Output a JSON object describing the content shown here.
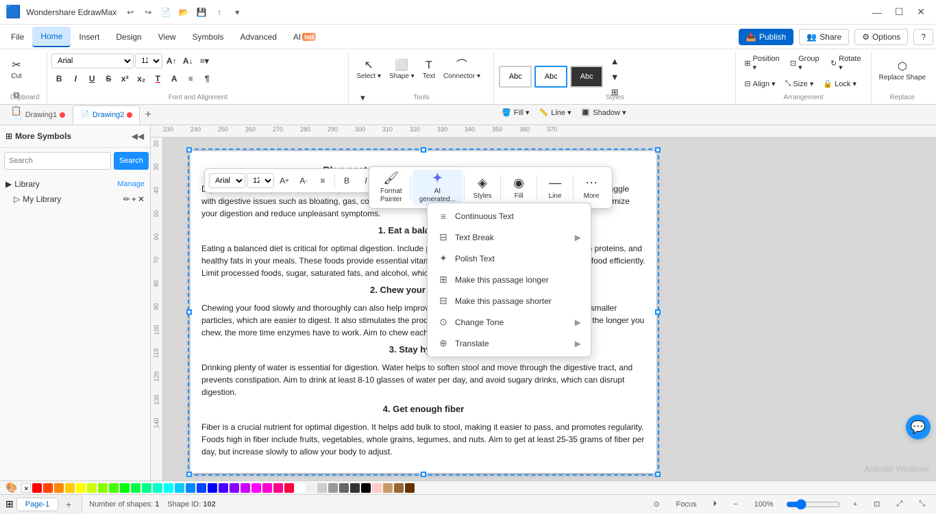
{
  "app": {
    "title": "Wondershare EdrawMax",
    "icon": "🟦"
  },
  "titlebar": {
    "controls": [
      "minimize",
      "maximize",
      "close"
    ],
    "quick_actions": [
      "undo",
      "redo",
      "new",
      "open",
      "save",
      "share",
      "more"
    ]
  },
  "menubar": {
    "items": [
      "File",
      "Home",
      "Insert",
      "Design",
      "View",
      "Symbols",
      "Advanced",
      "AI"
    ],
    "ai_badge": "hot",
    "active": "Home",
    "right_actions": [
      "Publish",
      "Share",
      "Options",
      "Help"
    ]
  },
  "ribbon": {
    "groups": [
      {
        "name": "Clipboard",
        "tools": [
          "Cut",
          "Copy",
          "Paste",
          "Format Painter"
        ]
      },
      {
        "name": "Font and Alignment",
        "font": "Arial",
        "size": "12",
        "bold": "B",
        "italic": "I",
        "underline": "U",
        "strike": "S",
        "superscript": "x²",
        "subscript": "x₂"
      },
      {
        "name": "Tools",
        "select_label": "Select",
        "shape_label": "Shape",
        "text_label": "Text",
        "connector_label": "Connector"
      },
      {
        "name": "Styles",
        "style_boxes": [
          "Abc",
          "Abc",
          "Abc"
        ],
        "fill_label": "Fill",
        "line_label": "Line",
        "shadow_label": "Shadow"
      },
      {
        "name": "Arrangement",
        "position_label": "Position",
        "group_label": "Group",
        "rotate_label": "Rotate",
        "align_label": "Align",
        "size_label": "Size",
        "lock_label": "Lock"
      },
      {
        "name": "Replace",
        "replace_shape_label": "Replace Shape"
      }
    ]
  },
  "tabs": [
    {
      "id": "drawing1",
      "label": "Drawing1",
      "active": false,
      "has_dot": true
    },
    {
      "id": "drawing2",
      "label": "Drawing2",
      "active": true,
      "has_dot": true
    }
  ],
  "sidebar": {
    "title": "More Symbols",
    "search_placeholder": "Search",
    "search_btn": "Search",
    "library_label": "Library",
    "my_library_label": "My Library",
    "manage_label": "Manage"
  },
  "canvas": {
    "content_title": "Blog post on how to improve your digestion",
    "paragraphs": [
      "Digestion is a vital process in our body that helps us break down food into nutrients and energy. Many people struggle with digestive issues such as bloating, gas, constipation, and diarrhea. Fortunately, there are several ways to optimize your digestion and reduce unpleasant symptoms.",
      "1. Eat a balanced diet",
      "Eating a balanced diet is critical for optimal digestion. Include plenty of fruits, vegetables, whole grains, lean proteins, and healthy fats in your meals. These foods provide essential vitamins, and minerals to help your body process food efficiently. Limit processed foods, sugar, saturated fats, and alcohol, which can disrupt digestion.",
      "2. Chew your food slowly",
      "Chewing your food slowly and thoroughly can also help improve digestion. Chewing breaks down food into smaller particles, which are easier to digest. It also stimulates the production of digestive enzymes in the mouth, so the longer you chew, the more time enzymes have to work. Aim to chew each bite 20-30 times before swallowing.",
      "3. Stay hydrated",
      "Drinking plenty of water is essential for digestion. Water helps to soften stool and move through the digestive tract, and prevents constipation. Aim to drink at least 8-10 glasses of water per day, and avoid sugary drinks, which can disrupt digestion.",
      "4. Get enough fiber",
      "Fiber is a crucial nutrient for optimal digestion. It helps add bulk to stool, making it easier to pass, and promotes regularity. Foods high in fiber include fruits, vegetables, whole grains, legumes, and nuts. Aim to get at least 25-35 grams of fiber per day, but increase slowly to allow your body to adjust."
    ]
  },
  "floating_toolbar": {
    "font": "Arial",
    "size": "12",
    "bold": "B",
    "italic": "I",
    "underline": "U",
    "strike": "S",
    "align": "≡",
    "color": "A"
  },
  "ai_toolbar": {
    "items": [
      {
        "id": "format-painter",
        "icon": "🖌",
        "label": "Format\nPainter"
      },
      {
        "id": "ai-generated",
        "icon": "✦",
        "label": "AI\ngenerated..."
      },
      {
        "id": "styles",
        "icon": "◈",
        "label": "Styles"
      },
      {
        "id": "fill",
        "icon": "◉",
        "label": "Fill"
      },
      {
        "id": "line",
        "icon": "—",
        "label": "Line"
      },
      {
        "id": "more",
        "icon": "⋯",
        "label": "More"
      }
    ]
  },
  "context_menu": {
    "items": [
      {
        "id": "continuous-text",
        "icon": "≡",
        "label": "Continuous Text",
        "has_arrow": false
      },
      {
        "id": "text-break",
        "icon": "⊟",
        "label": "Text Break",
        "has_arrow": true
      },
      {
        "id": "polish-text",
        "icon": "✦",
        "label": "Polish Text",
        "has_arrow": false
      },
      {
        "id": "make-longer",
        "icon": "⊞",
        "label": "Make this passage longer",
        "has_arrow": false
      },
      {
        "id": "make-shorter",
        "icon": "⊟",
        "label": "Make this passage shorter",
        "has_arrow": false
      },
      {
        "id": "change-tone",
        "icon": "⊙",
        "label": "Change Tone",
        "has_arrow": true
      },
      {
        "id": "translate",
        "icon": "⊕",
        "label": "Translate",
        "has_arrow": true
      }
    ]
  },
  "statusbar": {
    "page_label": "Page-1",
    "shapes_label": "Number of shapes:",
    "shapes_count": "1",
    "shape_id_label": "Shape ID:",
    "shape_id": "102",
    "focus_label": "Focus",
    "zoom_label": "100%",
    "page_tab": "Page-1"
  },
  "colors": [
    "#ff0000",
    "#ff4400",
    "#ff8800",
    "#ffcc00",
    "#ffff00",
    "#ccff00",
    "#88ff00",
    "#44ff00",
    "#00ff00",
    "#00ff44",
    "#00ff88",
    "#00ffcc",
    "#00ffff",
    "#00ccff",
    "#0088ff",
    "#0044ff",
    "#0000ff",
    "#4400ff",
    "#8800ff",
    "#cc00ff",
    "#ff00ff",
    "#ff00cc",
    "#ff0088",
    "#ff0044",
    "#ffffff",
    "#eeeeee",
    "#cccccc",
    "#999999",
    "#666666",
    "#333333",
    "#000000",
    "#ffcccc",
    "#cc9966",
    "#996633",
    "#663300"
  ]
}
